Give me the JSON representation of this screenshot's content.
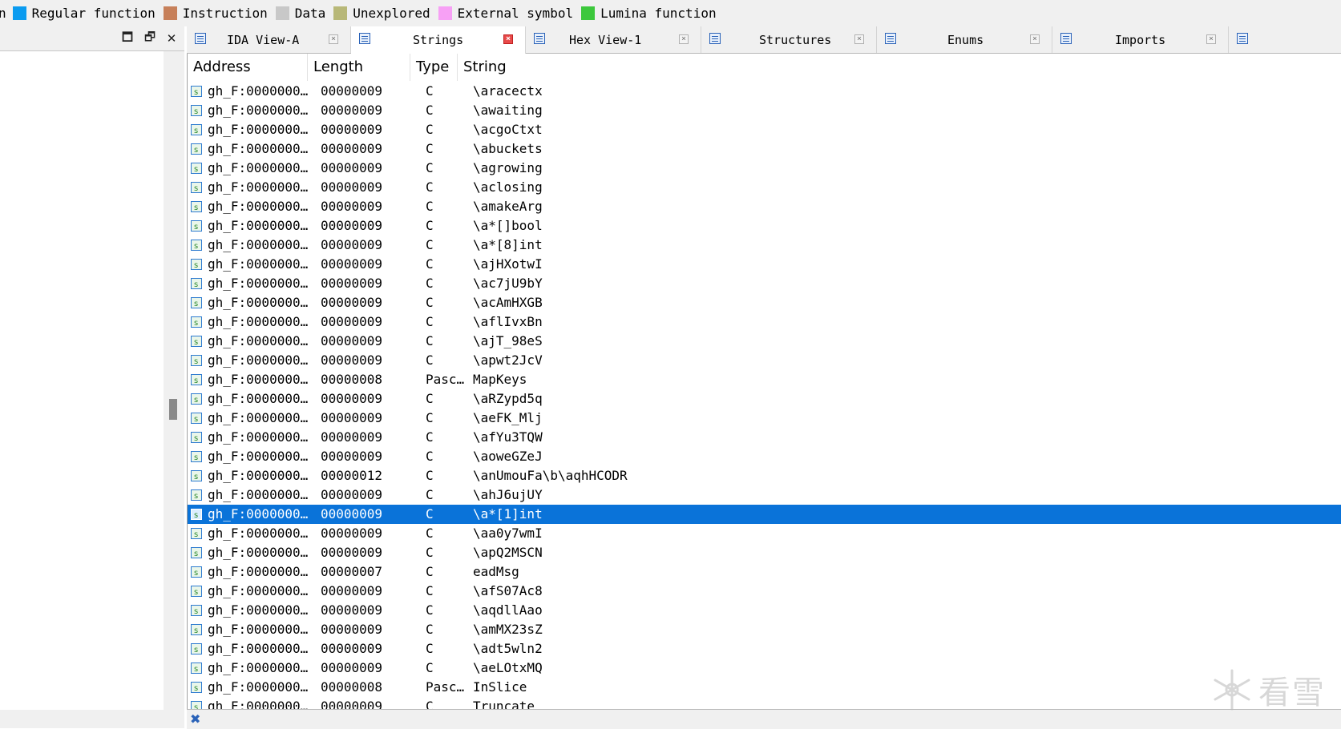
{
  "legend": {
    "lead_text": "n",
    "items": [
      {
        "label": "Regular function",
        "color": "#0a9bf0"
      },
      {
        "label": "Instruction",
        "color": "#c7805a"
      },
      {
        "label": "Data",
        "color": "#c8c8c8"
      },
      {
        "label": "Unexplored",
        "color": "#b8b878"
      },
      {
        "label": "External symbol",
        "color": "#f7a0f5"
      },
      {
        "label": "Lumina function",
        "color": "#3cc83c"
      }
    ]
  },
  "left_panel": {
    "maximize_glyph": "🗖",
    "restore_glyph": "🗗",
    "close_glyph": "✕"
  },
  "tabs": [
    {
      "label": "IDA View-A",
      "icon": "ida-view-icon",
      "active": false
    },
    {
      "label": "Strings",
      "icon": "strings-icon",
      "active": true
    },
    {
      "label": "Hex View-1",
      "icon": "hex-view-icon",
      "active": false
    },
    {
      "label": "Structures",
      "icon": "structures-icon",
      "active": false
    },
    {
      "label": "Enums",
      "icon": "enums-icon",
      "active": false
    },
    {
      "label": "Imports",
      "icon": "imports-icon",
      "active": false
    }
  ],
  "table": {
    "columns": [
      "Address",
      "Length",
      "Type",
      "String"
    ],
    "rows": [
      {
        "address": "gh_F:0000000…",
        "length": "00000009",
        "type": "C",
        "string": "\\aracectx"
      },
      {
        "address": "gh_F:0000000…",
        "length": "00000009",
        "type": "C",
        "string": "\\awaiting"
      },
      {
        "address": "gh_F:0000000…",
        "length": "00000009",
        "type": "C",
        "string": "\\acgoCtxt"
      },
      {
        "address": "gh_F:0000000…",
        "length": "00000009",
        "type": "C",
        "string": "\\abuckets"
      },
      {
        "address": "gh_F:0000000…",
        "length": "00000009",
        "type": "C",
        "string": "\\agrowing"
      },
      {
        "address": "gh_F:0000000…",
        "length": "00000009",
        "type": "C",
        "string": "\\aclosing"
      },
      {
        "address": "gh_F:0000000…",
        "length": "00000009",
        "type": "C",
        "string": "\\amakeArg"
      },
      {
        "address": "gh_F:0000000…",
        "length": "00000009",
        "type": "C",
        "string": "\\a*[]bool"
      },
      {
        "address": "gh_F:0000000…",
        "length": "00000009",
        "type": "C",
        "string": "\\a*[8]int"
      },
      {
        "address": "gh_F:0000000…",
        "length": "00000009",
        "type": "C",
        "string": "\\ajHXotwI"
      },
      {
        "address": "gh_F:0000000…",
        "length": "00000009",
        "type": "C",
        "string": "\\ac7jU9bY"
      },
      {
        "address": "gh_F:0000000…",
        "length": "00000009",
        "type": "C",
        "string": "\\acAmHXGB"
      },
      {
        "address": "gh_F:0000000…",
        "length": "00000009",
        "type": "C",
        "string": "\\aflIvxBn"
      },
      {
        "address": "gh_F:0000000…",
        "length": "00000009",
        "type": "C",
        "string": "\\ajT_98eS"
      },
      {
        "address": "gh_F:0000000…",
        "length": "00000009",
        "type": "C",
        "string": "\\apwt2JcV"
      },
      {
        "address": "gh_F:0000000…",
        "length": "00000008",
        "type": "Pasc…",
        "string": "MapKeys"
      },
      {
        "address": "gh_F:0000000…",
        "length": "00000009",
        "type": "C",
        "string": "\\aRZypd5q"
      },
      {
        "address": "gh_F:0000000…",
        "length": "00000009",
        "type": "C",
        "string": "\\aeFK_Mlj"
      },
      {
        "address": "gh_F:0000000…",
        "length": "00000009",
        "type": "C",
        "string": "\\afYu3TQW"
      },
      {
        "address": "gh_F:0000000…",
        "length": "00000009",
        "type": "C",
        "string": "\\aoweGZeJ"
      },
      {
        "address": "gh_F:0000000…",
        "length": "00000012",
        "type": "C",
        "string": "\\anUmouFa\\b\\aqhHCODR"
      },
      {
        "address": "gh_F:0000000…",
        "length": "00000009",
        "type": "C",
        "string": "\\ahJ6ujUY"
      },
      {
        "address": "gh_F:0000000…",
        "length": "00000009",
        "type": "C",
        "string": "\\a*[1]int",
        "selected": true
      },
      {
        "address": "gh_F:0000000…",
        "length": "00000009",
        "type": "C",
        "string": "\\aa0y7wmI"
      },
      {
        "address": "gh_F:0000000…",
        "length": "00000009",
        "type": "C",
        "string": "\\apQ2MSCN"
      },
      {
        "address": "gh_F:0000000…",
        "length": "00000007",
        "type": "C",
        "string": "eadMsg"
      },
      {
        "address": "gh_F:0000000…",
        "length": "00000009",
        "type": "C",
        "string": "\\afS07Ac8"
      },
      {
        "address": "gh_F:0000000…",
        "length": "00000009",
        "type": "C",
        "string": "\\aqdllAao"
      },
      {
        "address": "gh_F:0000000…",
        "length": "00000009",
        "type": "C",
        "string": "\\amMX23sZ"
      },
      {
        "address": "gh_F:0000000…",
        "length": "00000009",
        "type": "C",
        "string": "\\adt5wln2"
      },
      {
        "address": "gh_F:0000000…",
        "length": "00000009",
        "type": "C",
        "string": "\\aeLOtxMQ"
      },
      {
        "address": "gh_F:0000000…",
        "length": "00000008",
        "type": "Pasc…",
        "string": "InSlice"
      },
      {
        "address": "gh_F:0000000…",
        "length": "00000009",
        "type": "C",
        "string": "Truncate"
      }
    ]
  },
  "colors": {
    "selection": "#0a73d9",
    "background": "#ffffff",
    "chrome": "#f0f0f0"
  },
  "watermark": {
    "text": "看雪"
  }
}
